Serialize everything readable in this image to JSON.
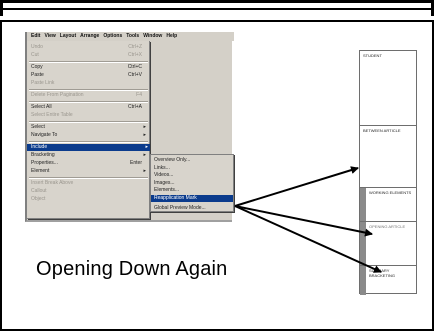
{
  "menubar": [
    "Edit",
    "View",
    "Layout",
    "Arrange",
    "Options",
    "Tools",
    "Window",
    "Help"
  ],
  "edit_menu": [
    {
      "label": "Undo",
      "shortcut": "Ctrl+Z",
      "dim": true
    },
    {
      "label": "Cut",
      "shortcut": "Ctrl+X",
      "dim": true
    },
    {
      "label": "Copy",
      "shortcut": "Ctrl+C",
      "dim": false
    },
    {
      "label": "Paste",
      "shortcut": "Ctrl+V",
      "dim": false
    },
    {
      "label": "Paste Link",
      "shortcut": "",
      "dim": true
    },
    {
      "label": "Delete From Pagination",
      "shortcut": "F4",
      "dim": true
    },
    {
      "label": "Select All",
      "shortcut": "Ctrl+A",
      "dim": false
    },
    {
      "label": "Select Entire Table",
      "shortcut": "",
      "dim": true
    },
    {
      "label": "Select",
      "shortcut": "",
      "arrow": true,
      "dim": false
    },
    {
      "label": "Navigate To",
      "shortcut": "",
      "arrow": true,
      "dim": false
    },
    {
      "label": "Include",
      "shortcut": "",
      "arrow": true,
      "dim": false,
      "highlight": true
    },
    {
      "label": "Bracketing",
      "shortcut": "",
      "arrow": true,
      "dim": false
    },
    {
      "label": "Properties...",
      "shortcut": "Enter",
      "dim": false
    },
    {
      "label": "Element",
      "shortcut": "",
      "arrow": true,
      "dim": false
    },
    {
      "label": "Insert Break Above",
      "shortcut": "",
      "dim": true
    },
    {
      "label": "Callout",
      "shortcut": "",
      "dim": true
    },
    {
      "label": "Object",
      "shortcut": "",
      "dim": true
    }
  ],
  "submenu": [
    {
      "label": "Overview Only...",
      "highlight": false
    },
    {
      "label": "Links...",
      "highlight": false
    },
    {
      "label": "Videos...",
      "highlight": false
    },
    {
      "label": "Images...",
      "highlight": false
    },
    {
      "label": "Elements...",
      "highlight": false
    },
    {
      "label": "Reapplication Mark",
      "highlight": true
    },
    {
      "label": "Global Preview Mode...",
      "highlight": false
    }
  ],
  "doc_strip": {
    "box1": "STUDENT",
    "box2": "BETWEEN ARTICLE",
    "box3": "WORKING ELEMENTS",
    "box4": "OPENING ARTICLE",
    "box5": "SUMMARY BRACKETING"
  },
  "caption": "Opening Down Again",
  "colors": {
    "highlight": "#0b3b8c",
    "menu_bg": "#d8d4cc"
  }
}
